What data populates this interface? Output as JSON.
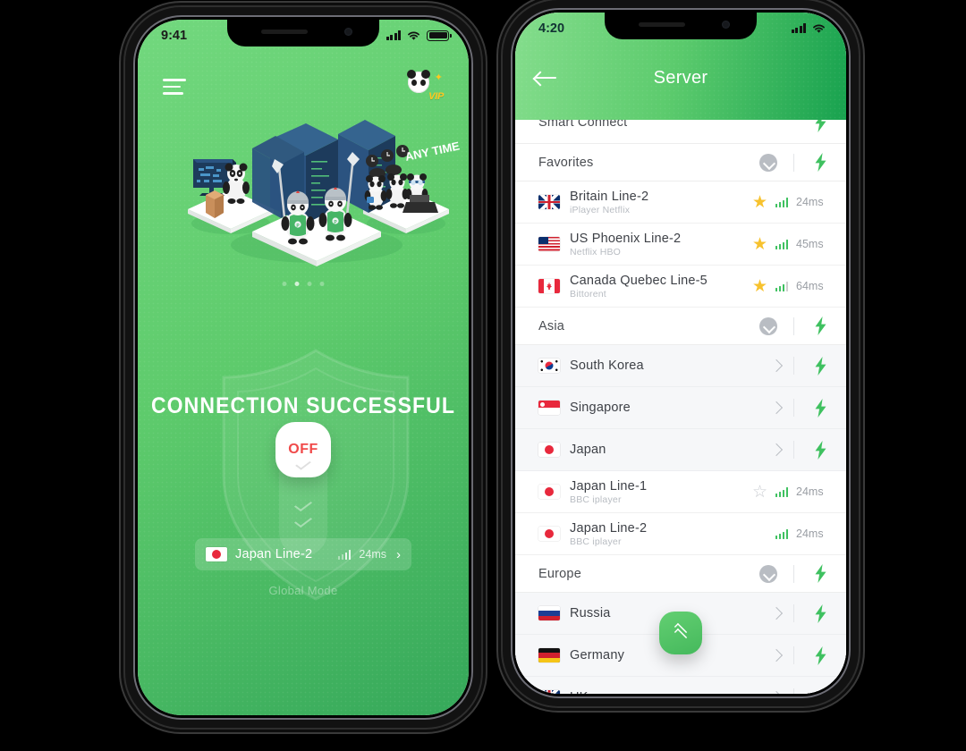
{
  "app": {
    "accent_green": "#5ccb6d",
    "dark_green": "#18a24f",
    "bolt_green": "#3fc160",
    "star_gold": "#f7c22e",
    "off_red": "#f04a4a"
  },
  "home": {
    "status": {
      "time": "9:41",
      "signal_icon": "cellular-bars-icon",
      "wifi_icon": "wifi-icon",
      "battery_icon": "battery-icon"
    },
    "menu_icon": "hamburger-menu-icon",
    "vip_badge": {
      "label": "VIP",
      "icon": "panda-vip-icon"
    },
    "illustration": {
      "name": "isometric-server-pandas-illustration",
      "sign_text": "ANY TIME",
      "monitor_label": "world-map-screen"
    },
    "carousel": {
      "dots": 4,
      "active_index": 1
    },
    "connection_title": "CONNECTION SUCCESSFUL",
    "toggle": {
      "label": "OFF",
      "state": "off"
    },
    "selected_server": {
      "country": "Japan",
      "name": "Japan Line-2",
      "ping": "24ms",
      "flag": "jp"
    },
    "mode_label": "Global Mode"
  },
  "server": {
    "status": {
      "time": "4:20",
      "signal_icon": "cellular-bars-icon",
      "wifi_icon": "wifi-icon"
    },
    "back_icon": "back-arrow-icon",
    "title": "Server",
    "smart_connect": {
      "label": "Smart Connect",
      "bolt": "lightning-bolt-icon"
    },
    "scroll_top_label": "scroll-to-top",
    "sections": [
      {
        "type": "group",
        "label": "Favorites",
        "collapse_icon": "chevron-down-circle-icon",
        "items": [
          {
            "type": "server",
            "flag": "gb",
            "name": "Britain Line-2",
            "tags": "iPlayer Netflix",
            "star": "filled",
            "ping": "24ms",
            "signal": 4
          },
          {
            "type": "server",
            "flag": "us",
            "name": "US Phoenix Line-2",
            "tags": "Netflix HBO",
            "star": "filled",
            "ping": "45ms",
            "signal": 4
          },
          {
            "type": "server",
            "flag": "ca",
            "name": "Canada Quebec Line-5",
            "tags": "Bittorent",
            "star": "filled",
            "ping": "64ms",
            "signal": 3
          }
        ]
      },
      {
        "type": "group",
        "label": "Asia",
        "collapse_icon": "chevron-down-circle-icon",
        "items": [
          {
            "type": "country",
            "flag": "kr",
            "name": "South Korea"
          },
          {
            "type": "country",
            "flag": "sg",
            "name": "Singapore"
          },
          {
            "type": "country",
            "flag": "jp",
            "name": "Japan"
          },
          {
            "type": "server",
            "flag": "jp",
            "name": "Japan Line-1",
            "tags": "BBC iplayer",
            "star": "outline",
            "ping": "24ms",
            "signal": 4
          },
          {
            "type": "server",
            "flag": "jp",
            "name": "Japan Line-2",
            "tags": "BBC iplayer",
            "star": "none",
            "ping": "24ms",
            "signal": 4
          }
        ]
      },
      {
        "type": "group",
        "label": "Europe",
        "collapse_icon": "chevron-down-circle-icon",
        "items": [
          {
            "type": "country",
            "flag": "ru",
            "name": "Russia"
          },
          {
            "type": "country",
            "flag": "de",
            "name": "Germany"
          },
          {
            "type": "country",
            "flag": "gb",
            "name": "UK"
          }
        ]
      }
    ]
  }
}
